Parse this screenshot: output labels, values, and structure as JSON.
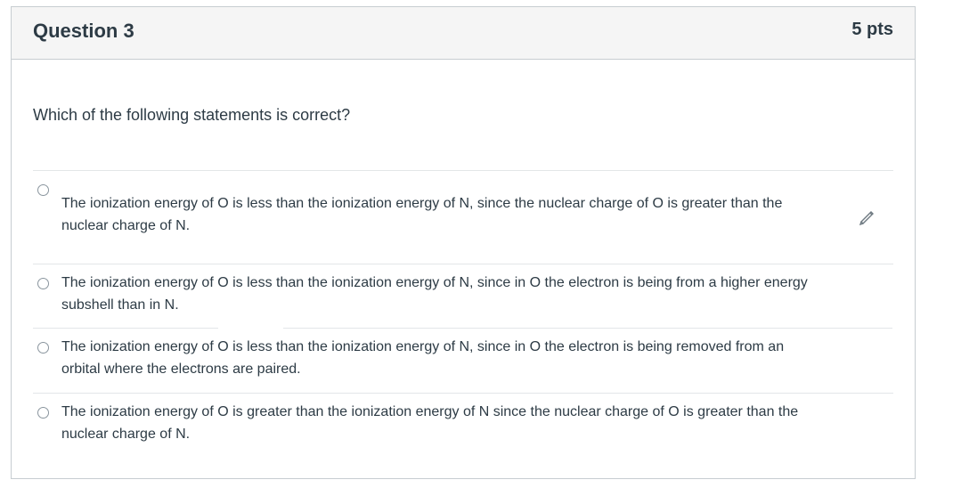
{
  "question": {
    "title": "Question 3",
    "points": "5 pts",
    "text": "Which of the following statements is correct?"
  },
  "answers": [
    {
      "line1": "The ionization energy of O is less than the ionization energy of N, since the nuclear charge of O is greater than the",
      "line2": "nuclear charge of N."
    },
    {
      "line1": "The ionization energy of O is less than the ionization energy of N, since in O the electron is being from a higher energy",
      "line2": "subshell than in N."
    },
    {
      "line1": "The ionization energy of O is less than the ionization energy of N, since in O the electron is being removed from an",
      "line2": "orbital where the electrons are paired."
    },
    {
      "line1": "The ionization energy of O is greater than the ionization energy of N since the nuclear charge of O is greater than the",
      "line2": "nuclear charge of N."
    }
  ],
  "icons": {
    "edit": "pencil-icon"
  }
}
